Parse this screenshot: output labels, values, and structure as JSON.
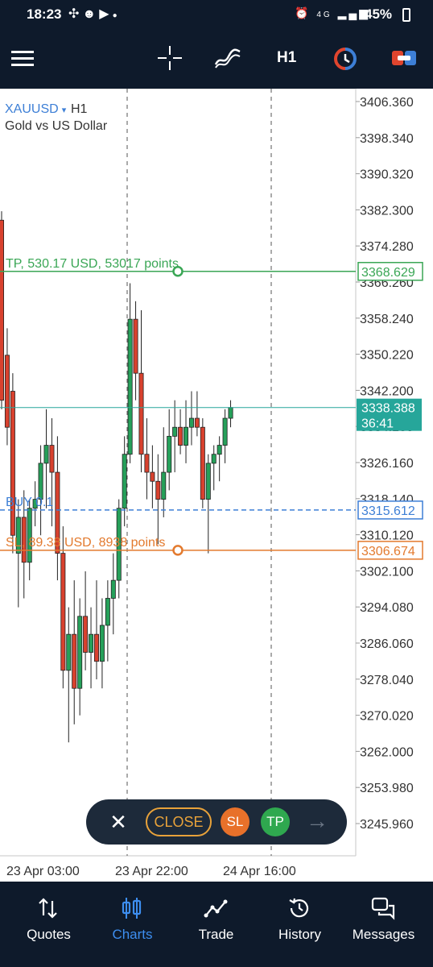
{
  "status_bar": {
    "time": "18:23",
    "notification_icons": [
      "pinwheel-icon",
      "snapchat-icon",
      "youtube-icon",
      "dot-icon"
    ],
    "network": "4G",
    "battery": "45%"
  },
  "toolbar": {
    "menu_icon": "hamburger-icon",
    "crosshair_icon": "crosshair-icon",
    "indicators_icon": "indicators-icon",
    "timeframe": "H1",
    "one_click_icon": "one-click-trading-icon",
    "new_order_icon": "new-order-icon"
  },
  "chart": {
    "symbol": "XAUUSD",
    "symbol_caret": "▾",
    "timeframe": "H1",
    "description": "Gold vs US Dollar",
    "price_labels": [
      "3406.360",
      "3398.340",
      "3390.320",
      "3382.300",
      "3374.280",
      "3366.260",
      "3358.240",
      "3350.220",
      "3342.200",
      "3334.180",
      "3326.160",
      "3318.140",
      "3310.120",
      "3302.100",
      "3294.080",
      "3286.060",
      "3278.040",
      "3270.020",
      "3262.000",
      "3253.980",
      "3245.960"
    ],
    "time_labels": [
      "23 Apr 03:00",
      "23 Apr 22:00",
      "24 Apr 16:00"
    ],
    "tp_line": {
      "label": "TP, 530.17 USD, 53017 points",
      "price": "3368.629",
      "color": "#3aa655"
    },
    "current_price": {
      "price": "3338.388",
      "countdown": "36:41",
      "color": "#26a69a"
    },
    "buy_line": {
      "label": "BUY 0.1",
      "price": "3315.612",
      "color": "#3d7fd6"
    },
    "sl_line": {
      "label": "SL, 89.38 USD, 8938 points",
      "price": "3306.674",
      "color": "#e37a2e"
    },
    "bull_color": "#26a05a",
    "bear_color": "#d8412e"
  },
  "chart_data": {
    "type": "candlestick",
    "symbol": "XAUUSD",
    "timeframe": "H1",
    "ylim": [
      3241,
      3411
    ],
    "candles": [
      {
        "o": 3380,
        "h": 3382,
        "l": 3338,
        "c": 3340
      },
      {
        "o": 3350,
        "h": 3356,
        "l": 3330,
        "c": 3334
      },
      {
        "o": 3342,
        "h": 3346,
        "l": 3306,
        "c": 3310
      },
      {
        "o": 3306,
        "h": 3318,
        "l": 3294,
        "c": 3314
      },
      {
        "o": 3314,
        "h": 3320,
        "l": 3296,
        "c": 3304
      },
      {
        "o": 3304,
        "h": 3318,
        "l": 3300,
        "c": 3316
      },
      {
        "o": 3316,
        "h": 3322,
        "l": 3312,
        "c": 3318
      },
      {
        "o": 3318,
        "h": 3330,
        "l": 3310,
        "c": 3326
      },
      {
        "o": 3326,
        "h": 3338,
        "l": 3316,
        "c": 3330
      },
      {
        "o": 3330,
        "h": 3336,
        "l": 3312,
        "c": 3324
      },
      {
        "o": 3324,
        "h": 3332,
        "l": 3300,
        "c": 3306
      },
      {
        "o": 3306,
        "h": 3312,
        "l": 3276,
        "c": 3280
      },
      {
        "o": 3280,
        "h": 3294,
        "l": 3264,
        "c": 3288
      },
      {
        "o": 3288,
        "h": 3300,
        "l": 3268,
        "c": 3276
      },
      {
        "o": 3276,
        "h": 3296,
        "l": 3270,
        "c": 3292
      },
      {
        "o": 3292,
        "h": 3302,
        "l": 3280,
        "c": 3284
      },
      {
        "o": 3284,
        "h": 3294,
        "l": 3276,
        "c": 3288
      },
      {
        "o": 3288,
        "h": 3300,
        "l": 3278,
        "c": 3282
      },
      {
        "o": 3282,
        "h": 3296,
        "l": 3276,
        "c": 3290
      },
      {
        "o": 3290,
        "h": 3300,
        "l": 3282,
        "c": 3296
      },
      {
        "o": 3296,
        "h": 3306,
        "l": 3288,
        "c": 3300
      },
      {
        "o": 3300,
        "h": 3318,
        "l": 3296,
        "c": 3316
      },
      {
        "o": 3316,
        "h": 3332,
        "l": 3312,
        "c": 3328
      },
      {
        "o": 3328,
        "h": 3366,
        "l": 3326,
        "c": 3358
      },
      {
        "o": 3358,
        "h": 3362,
        "l": 3340,
        "c": 3346
      },
      {
        "o": 3346,
        "h": 3360,
        "l": 3324,
        "c": 3328
      },
      {
        "o": 3328,
        "h": 3336,
        "l": 3318,
        "c": 3324
      },
      {
        "o": 3324,
        "h": 3330,
        "l": 3316,
        "c": 3322
      },
      {
        "o": 3322,
        "h": 3328,
        "l": 3308,
        "c": 3318
      },
      {
        "o": 3318,
        "h": 3334,
        "l": 3314,
        "c": 3324
      },
      {
        "o": 3324,
        "h": 3338,
        "l": 3320,
        "c": 3332
      },
      {
        "o": 3332,
        "h": 3340,
        "l": 3324,
        "c": 3334
      },
      {
        "o": 3334,
        "h": 3338,
        "l": 3328,
        "c": 3330
      },
      {
        "o": 3330,
        "h": 3340,
        "l": 3326,
        "c": 3334
      },
      {
        "o": 3334,
        "h": 3342,
        "l": 3330,
        "c": 3336
      },
      {
        "o": 3336,
        "h": 3342,
        "l": 3332,
        "c": 3334
      },
      {
        "o": 3334,
        "h": 3336,
        "l": 3316,
        "c": 3318
      },
      {
        "o": 3318,
        "h": 3328,
        "l": 3306,
        "c": 3326
      },
      {
        "o": 3326,
        "h": 3330,
        "l": 3320,
        "c": 3328
      },
      {
        "o": 3328,
        "h": 3332,
        "l": 3322,
        "c": 3330
      },
      {
        "o": 3330,
        "h": 3338,
        "l": 3326,
        "c": 3336
      },
      {
        "o": 3336,
        "h": 3340,
        "l": 3334,
        "c": 3338.388
      }
    ]
  },
  "trade_panel": {
    "close_icon": "close-icon",
    "close_label": "CLOSE",
    "sl_label": "SL",
    "tp_label": "TP",
    "arrow_icon": "arrow-right-icon"
  },
  "bottom_nav": {
    "items": [
      {
        "label": "Quotes",
        "icon": "quotes-icon",
        "active": false
      },
      {
        "label": "Charts",
        "icon": "charts-icon",
        "active": true
      },
      {
        "label": "Trade",
        "icon": "trade-icon",
        "active": false
      },
      {
        "label": "History",
        "icon": "history-icon",
        "active": false
      },
      {
        "label": "Messages",
        "icon": "messages-icon",
        "active": false
      }
    ]
  }
}
